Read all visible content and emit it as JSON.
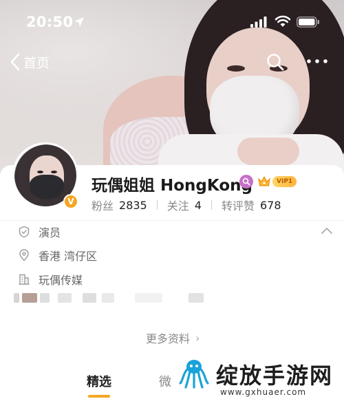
{
  "status_bar": {
    "time": "20:50",
    "icons": [
      "location-arrow-icon",
      "signal-icon",
      "wifi-icon",
      "battery-icon"
    ]
  },
  "nav": {
    "back_label": "首页",
    "icons": [
      "chevron-left-icon",
      "search-icon",
      "more-icon"
    ]
  },
  "profile": {
    "name": "玩偶姐姐 HongKong",
    "verified_badge": "V",
    "vip_label": "VIP1",
    "stats": [
      {
        "label": "粉丝",
        "value": "2835"
      },
      {
        "label": "关注",
        "value": "4"
      },
      {
        "label": "转评赞",
        "value": "678"
      }
    ]
  },
  "info": {
    "occupation": "演员",
    "location": "香港 湾仔区",
    "company": "玩偶传媒"
  },
  "more_info": {
    "label": "更多资料",
    "chevron": "›"
  },
  "tabs": [
    {
      "label": "精选",
      "active": true
    },
    {
      "label": "微",
      "active": false
    }
  ],
  "watermark": {
    "title": "绽放手游网",
    "url": "www.gxhuaer.com"
  },
  "colors": {
    "accent": "#f5a623",
    "vip_gradient_start": "#ffd665",
    "vip_gradient_end": "#ffb23b",
    "search_badge": "#c770c8",
    "text_primary": "#222222",
    "text_secondary": "#888888"
  }
}
